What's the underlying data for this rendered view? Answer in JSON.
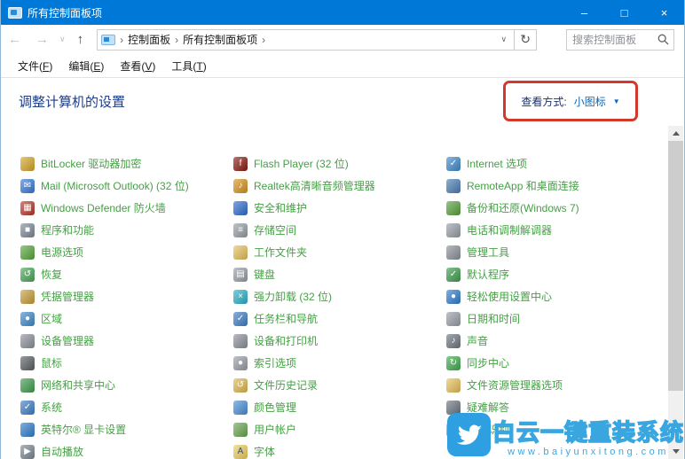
{
  "window": {
    "title": "所有控制面板项"
  },
  "titlebar": {
    "controls": {
      "minimize": "–",
      "maximize": "□",
      "close": "×"
    }
  },
  "icons": {
    "back": "←",
    "forward": "→",
    "dropdown": "∨",
    "up": "↑",
    "breadcrumb_sep": "›",
    "address_chevron": "∨",
    "refresh": "↻",
    "view_caret": "▼"
  },
  "nav": {
    "breadcrumb": [
      "控制面板",
      "所有控制面板项"
    ],
    "search_placeholder": "搜索控制面板"
  },
  "menu": {
    "items": [
      {
        "label": "文件",
        "key": "F"
      },
      {
        "label": "编辑",
        "key": "E"
      },
      {
        "label": "查看",
        "key": "V"
      },
      {
        "label": "工具",
        "key": "T"
      }
    ]
  },
  "header": {
    "title": "调整计算机的设置",
    "view_by_label": "查看方式:",
    "view_by_value": "小图标"
  },
  "colors": {
    "titlebar": "#0078d7",
    "item_link": "#45a045",
    "highlight_box": "#d3392b",
    "view_link": "#0667c0",
    "page_title": "#1e3c87",
    "watermark_blue": "#3aa6e0"
  },
  "columns": [
    [
      {
        "label": "BitLocker 驱动器加密",
        "icon": "bitlocker-icon",
        "color": "#d7a728",
        "glyph": ""
      },
      {
        "label": "Mail (Microsoft Outlook) (32 位)",
        "icon": "mail-icon",
        "color": "#3a7ad9",
        "glyph": "✉"
      },
      {
        "label": "Windows Defender 防火墙",
        "icon": "firewall-icon",
        "color": "#b8392b",
        "glyph": "▦"
      },
      {
        "label": "程序和功能",
        "icon": "programs-features-icon",
        "color": "#7f8c9a",
        "glyph": "■"
      },
      {
        "label": "电源选项",
        "icon": "power-options-icon",
        "color": "#58a83c",
        "glyph": ""
      },
      {
        "label": "恢复",
        "icon": "recovery-icon",
        "color": "#49a85a",
        "glyph": "↺"
      },
      {
        "label": "凭据管理器",
        "icon": "credential-manager-icon",
        "color": "#c9a13b",
        "glyph": ""
      },
      {
        "label": "区域",
        "icon": "region-icon",
        "color": "#3f8ccc",
        "glyph": "●"
      },
      {
        "label": "设备管理器",
        "icon": "device-manager-icon",
        "color": "#8d9399",
        "glyph": ""
      },
      {
        "label": "鼠标",
        "icon": "mouse-icon",
        "color": "#5a6066",
        "glyph": ""
      },
      {
        "label": "网络和共享中心",
        "icon": "network-sharing-icon",
        "color": "#3f9e4d",
        "glyph": ""
      },
      {
        "label": "系统",
        "icon": "system-icon",
        "color": "#3f80c8",
        "glyph": "✓"
      },
      {
        "label": "英特尔® 显卡设置",
        "icon": "intel-graphics-icon",
        "color": "#2f7fd0",
        "glyph": ""
      },
      {
        "label": "自动播放",
        "icon": "autoplay-icon",
        "color": "#7e8a94",
        "glyph": "▶"
      }
    ],
    [
      {
        "label": "Flash Player (32 位)",
        "icon": "flash-player-icon",
        "color": "#8e1b12",
        "glyph": "f"
      },
      {
        "label": "Realtek高清晰音频管理器",
        "icon": "realtek-audio-icon",
        "color": "#d9941f",
        "glyph": "♪"
      },
      {
        "label": "安全和维护",
        "icon": "security-maintenance-icon",
        "color": "#2f6fd0",
        "glyph": ""
      },
      {
        "label": "存储空间",
        "icon": "storage-spaces-icon",
        "color": "#98a0a8",
        "glyph": "≡"
      },
      {
        "label": "工作文件夹",
        "icon": "work-folders-icon",
        "color": "#e8c25a",
        "glyph": ""
      },
      {
        "label": "键盘",
        "icon": "keyboard-icon",
        "color": "#9aa1a8",
        "glyph": "▤"
      },
      {
        "label": "强力卸载 (32 位)",
        "icon": "uninstaller-icon",
        "color": "#2bb3c9",
        "glyph": "×"
      },
      {
        "label": "任务栏和导航",
        "icon": "taskbar-navigation-icon",
        "color": "#3f80c8",
        "glyph": "✓"
      },
      {
        "label": "设备和打印机",
        "icon": "devices-printers-icon",
        "color": "#8d9399",
        "glyph": ""
      },
      {
        "label": "索引选项",
        "icon": "indexing-options-icon",
        "color": "#9aa1a8",
        "glyph": "●"
      },
      {
        "label": "文件历史记录",
        "icon": "file-history-icon",
        "color": "#e0b94f",
        "glyph": "↺"
      },
      {
        "label": "颜色管理",
        "icon": "color-management-icon",
        "color": "#4a90d9",
        "glyph": ""
      },
      {
        "label": "用户帐户",
        "icon": "user-accounts-icon",
        "color": "#6aa84f",
        "glyph": ""
      },
      {
        "label": "字体",
        "icon": "fonts-icon",
        "color": "#f0d060",
        "glyph": "A",
        "glyph_color": "#1f4fa0"
      }
    ],
    [
      {
        "label": "Internet 选项",
        "icon": "internet-options-icon",
        "color": "#3f8ccc",
        "glyph": "✓"
      },
      {
        "label": "RemoteApp 和桌面连接",
        "icon": "remoteapp-icon",
        "color": "#4a7fb5",
        "glyph": ""
      },
      {
        "label": "备份和还原(Windows 7)",
        "icon": "backup-restore-icon",
        "color": "#57a33c",
        "glyph": ""
      },
      {
        "label": "电话和调制解调器",
        "icon": "phone-modem-icon",
        "color": "#98a0a8",
        "glyph": ""
      },
      {
        "label": "管理工具",
        "icon": "admin-tools-icon",
        "color": "#8d9399",
        "glyph": ""
      },
      {
        "label": "默认程序",
        "icon": "default-programs-icon",
        "color": "#3f9e4d",
        "glyph": "✓"
      },
      {
        "label": "轻松使用设置中心",
        "icon": "ease-of-access-icon",
        "color": "#2f7fd0",
        "glyph": "●"
      },
      {
        "label": "日期和时间",
        "icon": "date-time-icon",
        "color": "#9aa1a8",
        "glyph": ""
      },
      {
        "label": "声音",
        "icon": "sound-icon",
        "color": "#707880",
        "glyph": "♪"
      },
      {
        "label": "同步中心",
        "icon": "sync-center-icon",
        "color": "#3fae4f",
        "glyph": "↻"
      },
      {
        "label": "文件资源管理器选项",
        "icon": "file-explorer-options-icon",
        "color": "#e8c25a",
        "glyph": ""
      },
      {
        "label": "疑难解答",
        "icon": "troubleshooting-icon",
        "color": "#6b7680",
        "glyph": ""
      },
      {
        "label": "语音识别",
        "icon": "speech-recognition-icon",
        "color": "#9aa1a8",
        "glyph": ""
      }
    ]
  ],
  "watermark": {
    "title": "白云一键重装系统",
    "url": "www.baiyunxitong.com"
  }
}
